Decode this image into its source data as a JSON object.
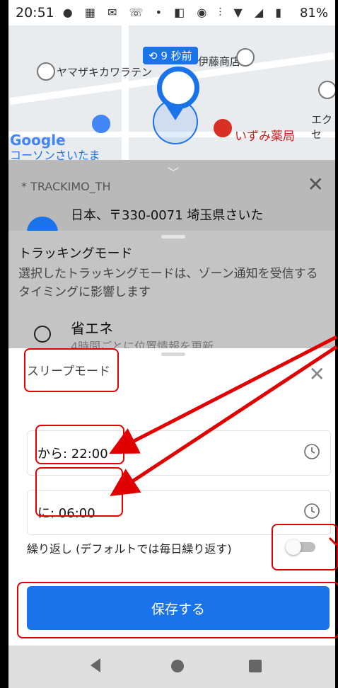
{
  "status_bar": {
    "time": "20:51",
    "icons": "● ▦ ✉ ☏ • ◧ ◉ ⫶ ▼ ◢ ▮",
    "battery": "81%"
  },
  "map": {
    "time_ago_badge": "⟲ 9 秒前",
    "poi_1": "ヤマザキカワラテン",
    "poi_2": "伊藤商店",
    "poi_3": "いずみ薬局",
    "poi_4": "エクセ",
    "google_logo": "Google",
    "poi_5": "コーソンさいたま"
  },
  "device_sheet": {
    "device_name": "* TRACKIMO_TH",
    "address": "日本、〒330-0071 埼玉県さいた"
  },
  "tracking_sheet": {
    "title": "トラッキングモード",
    "description": "選択したトラッキングモードは、ゾーン通知を受信するタイミングに影響します",
    "option_name": "省エネ",
    "option_sub": "4時間ごとに位置情報を更新"
  },
  "sleep_dialog": {
    "title": "スリープモード",
    "from_field": "から: 22:00",
    "to_field": "に: 06:00",
    "repeat_label": "繰り返し (デフォルトでは毎日繰り返す)",
    "repeat_enabled": false,
    "save_label": "保存する"
  },
  "colors": {
    "accent": "#1a73e8",
    "annotation": "#e10000"
  }
}
